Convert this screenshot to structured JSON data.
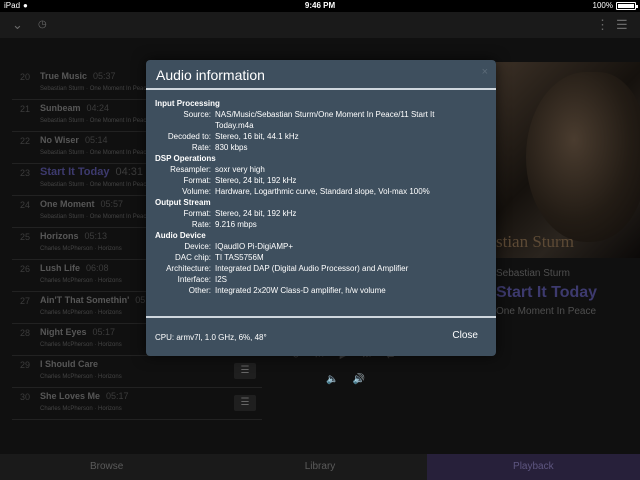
{
  "status_bar": {
    "device": "iPad",
    "time": "9:46 PM",
    "battery": "100%",
    "battery_level": 1.0
  },
  "queue": [
    {
      "num": "20",
      "title": "True Music",
      "duration": "05:37",
      "artist": "Sebastian Sturm · One Moment In Peace",
      "current": false,
      "menu": false
    },
    {
      "num": "21",
      "title": "Sunbeam",
      "duration": "04:24",
      "artist": "Sebastian Sturm · One Moment In Peace",
      "current": false,
      "menu": false
    },
    {
      "num": "22",
      "title": "No Wiser",
      "duration": "05:14",
      "artist": "Sebastian Sturm · One Moment In Peace",
      "current": false,
      "menu": false
    },
    {
      "num": "23",
      "title": "Start It Today",
      "duration": "04:31",
      "artist": "Sebastian Sturm · One Moment In Peace",
      "current": true,
      "menu": false
    },
    {
      "num": "24",
      "title": "One Moment",
      "duration": "05:57",
      "artist": "Sebastian Sturm · One Moment In Peace",
      "current": false,
      "menu": false
    },
    {
      "num": "25",
      "title": "Horizons",
      "duration": "05:13",
      "artist": "Charles McPherson · Horizons",
      "current": false,
      "menu": false
    },
    {
      "num": "26",
      "title": "Lush Life",
      "duration": "06:08",
      "artist": "Charles McPherson · Horizons",
      "current": false,
      "menu": false
    },
    {
      "num": "27",
      "title": "Ain'T That Somethin'",
      "duration": "05:26",
      "artist": "Charles McPherson · Horizons",
      "current": false,
      "menu": false
    },
    {
      "num": "28",
      "title": "Night Eyes",
      "duration": "05:17",
      "artist": "Charles McPherson · Horizons",
      "current": false,
      "menu": false
    },
    {
      "num": "29",
      "title": "I Should Care",
      "duration": "",
      "artist": "Charles McPherson · Horizons",
      "current": false,
      "menu": true
    },
    {
      "num": "30",
      "title": "She Loves Me",
      "duration": "05:17",
      "artist": "Charles McPherson · Horizons",
      "current": false,
      "menu": true
    }
  ],
  "album_art": {
    "text": "stian Sturm"
  },
  "now_playing": {
    "artist": "Sebastian Sturm",
    "title": "Start It Today",
    "album": "One Moment In Peace"
  },
  "nav": {
    "browse": "Browse",
    "library": "Library",
    "playback": "Playback"
  },
  "modal": {
    "title": "Audio information",
    "close_x": "×",
    "sections": [
      {
        "title": "Input Processing",
        "rows": [
          {
            "key": "Source:",
            "value": "NAS/Music/Sebastian Sturm/One Moment In Peace/11 Start It Today.m4a"
          },
          {
            "key": "Decoded to:",
            "value": "Stereo, 16 bit, 44.1 kHz"
          },
          {
            "key": "Rate:",
            "value": "830 kbps"
          }
        ]
      },
      {
        "title": "DSP Operations",
        "rows": [
          {
            "key": "Resampler:",
            "value": "soxr very high"
          },
          {
            "key": "Format:",
            "value": "Stereo, 24 bit, 192 kHz"
          },
          {
            "key": "Volume:",
            "value": "Hardware, Logarthmic curve, Standard slope, Vol-max 100%"
          }
        ]
      },
      {
        "title": "Output Stream",
        "rows": [
          {
            "key": "Format:",
            "value": "Stereo, 24 bit, 192 kHz"
          },
          {
            "key": "Rate:",
            "value": "9.216 mbps"
          }
        ]
      },
      {
        "title": "Audio Device",
        "rows": [
          {
            "key": "Device:",
            "value": "IQaudIO Pi-DigiAMP+"
          },
          {
            "key": "DAC chip:",
            "value": "TI TAS5756M"
          },
          {
            "key": "Architecture:",
            "value": "Integrated DAP (Digital Audio Processor) and Amplifier"
          },
          {
            "key": "Interface:",
            "value": "I2S"
          },
          {
            "key": "Other:",
            "value": "Integrated 2x20W Class-D amplifier, h/w volume"
          }
        ]
      }
    ],
    "cpu": "CPU: armv7l, 1.0 GHz, 6%, 48°",
    "close_label": "Close"
  },
  "icons": [
    "wifi-icon",
    "battery-icon",
    "chevron-down-icon",
    "clock-icon",
    "ellipsis-icon",
    "hamburger-menu-icon",
    "volume-down-icon",
    "volume-up-icon",
    "close-icon"
  ]
}
